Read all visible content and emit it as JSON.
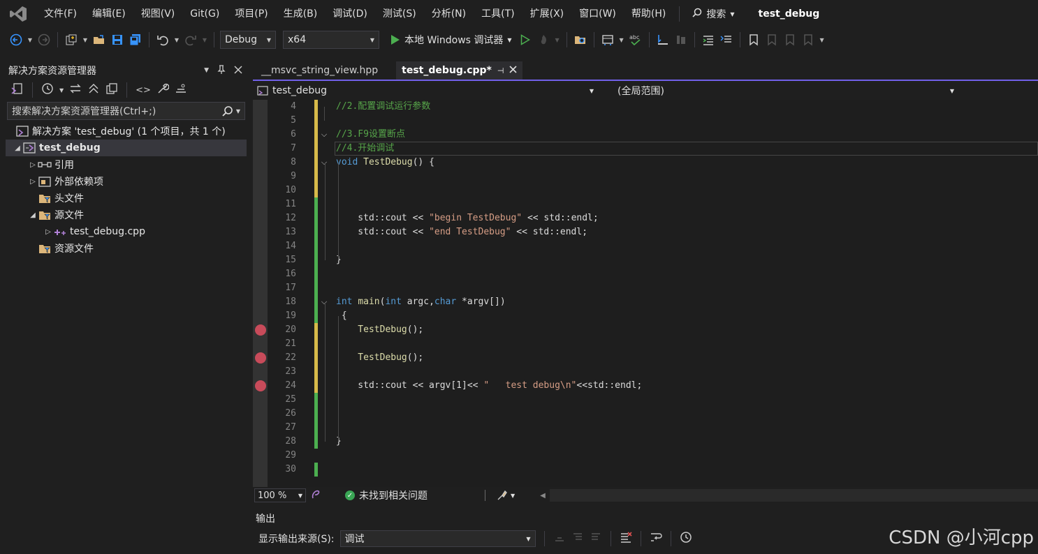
{
  "menu": {
    "items": [
      "文件(F)",
      "编辑(E)",
      "视图(V)",
      "Git(G)",
      "项目(P)",
      "生成(B)",
      "调试(D)",
      "测试(S)",
      "分析(N)",
      "工具(T)",
      "扩展(X)",
      "窗口(W)",
      "帮助(H)"
    ],
    "search_label": "搜索",
    "project_title": "test_debug"
  },
  "toolbar": {
    "config": "Debug",
    "platform": "x64",
    "run_label": "本地 Windows 调试器"
  },
  "solution_explorer": {
    "title": "解决方案资源管理器",
    "search_placeholder": "搜索解决方案资源管理器(Ctrl+;)",
    "tree": [
      {
        "label": "解决方案 'test_debug' (1 个项目，共 1 个)",
        "expander": "",
        "icon": "solution-icon"
      },
      {
        "label": "test_debug",
        "expander": "◢",
        "icon": "project-icon"
      },
      {
        "label": "引用",
        "expander": "▷",
        "icon": "references-icon"
      },
      {
        "label": "外部依赖项",
        "expander": "▷",
        "icon": "external-deps-icon"
      },
      {
        "label": "头文件",
        "expander": "",
        "icon": "filter-folder-icon"
      },
      {
        "label": "源文件",
        "expander": "◢",
        "icon": "filter-folder-icon"
      },
      {
        "label": "test_debug.cpp",
        "expander": "▷",
        "icon": "cpp-file-icon"
      },
      {
        "label": "资源文件",
        "expander": "",
        "icon": "filter-folder-icon"
      }
    ]
  },
  "editor": {
    "tabs": [
      {
        "label": "__msvc_string_view.hpp",
        "active": false
      },
      {
        "label": "test_debug.cpp*",
        "active": true
      }
    ],
    "nav_left": "test_debug",
    "nav_right": "(全局范围)",
    "lines": [
      {
        "n": "4",
        "parts": [
          [
            "cm",
            "//2.配置调试运行参数"
          ]
        ]
      },
      {
        "n": "5",
        "parts": []
      },
      {
        "n": "6",
        "parts": [
          [
            "cm",
            "//3.F9设置断点"
          ]
        ]
      },
      {
        "n": "7",
        "parts": [
          [
            "cm",
            "//4.开始调试"
          ]
        ]
      },
      {
        "n": "8",
        "parts": [
          [
            "kw",
            "void "
          ],
          [
            "fn",
            "TestDebug"
          ],
          [
            "tx",
            "() {"
          ]
        ]
      },
      {
        "n": "9",
        "parts": []
      },
      {
        "n": "10",
        "parts": []
      },
      {
        "n": "11",
        "parts": []
      },
      {
        "n": "12",
        "parts": [
          [
            "tx",
            "    std::cout << "
          ],
          [
            "st",
            "\"begin TestDebug\""
          ],
          [
            "tx",
            " << std::endl;"
          ]
        ]
      },
      {
        "n": "13",
        "parts": [
          [
            "tx",
            "    std::cout << "
          ],
          [
            "st",
            "\"end TestDebug\""
          ],
          [
            "tx",
            " << std::endl;"
          ]
        ]
      },
      {
        "n": "14",
        "parts": []
      },
      {
        "n": "15",
        "parts": [
          [
            "tx",
            "}"
          ]
        ]
      },
      {
        "n": "16",
        "parts": []
      },
      {
        "n": "17",
        "parts": []
      },
      {
        "n": "18",
        "parts": [
          [
            "kw",
            "int "
          ],
          [
            "fn",
            "main"
          ],
          [
            "tx",
            "("
          ],
          [
            "kw",
            "int"
          ],
          [
            "tx",
            " argc,"
          ],
          [
            "kw",
            "char"
          ],
          [
            "tx",
            " *argv[])"
          ]
        ]
      },
      {
        "n": "19",
        "parts": [
          [
            "tx",
            " {"
          ]
        ]
      },
      {
        "n": "20",
        "parts": [
          [
            "fn",
            "    TestDebug"
          ],
          [
            "tx",
            "();"
          ]
        ]
      },
      {
        "n": "21",
        "parts": []
      },
      {
        "n": "22",
        "parts": [
          [
            "fn",
            "    TestDebug"
          ],
          [
            "tx",
            "();"
          ]
        ]
      },
      {
        "n": "23",
        "parts": []
      },
      {
        "n": "24",
        "parts": [
          [
            "tx",
            "    std::cout << argv[1]<< "
          ],
          [
            "st",
            "\"   test debug\\n\""
          ],
          [
            "tx",
            "<<std::endl;"
          ]
        ]
      },
      {
        "n": "25",
        "parts": []
      },
      {
        "n": "26",
        "parts": []
      },
      {
        "n": "27",
        "parts": []
      },
      {
        "n": "28",
        "parts": [
          [
            "tx",
            "}"
          ]
        ]
      },
      {
        "n": "29",
        "parts": []
      },
      {
        "n": "30",
        "parts": []
      }
    ],
    "breakpoint_lines": [
      "20",
      "22",
      "24"
    ]
  },
  "status": {
    "zoom": "100 %",
    "issues": "未找到相关问题"
  },
  "output": {
    "title": "输出",
    "source_label": "显示输出来源(S):",
    "source_value": "调试"
  },
  "watermark": "CSDN @小河cpp",
  "colors": {
    "accent": "#7160e8",
    "breakpoint": "#c84b5a",
    "change_saved": "#4caf50",
    "change_unsaved": "#d7ba4a"
  }
}
